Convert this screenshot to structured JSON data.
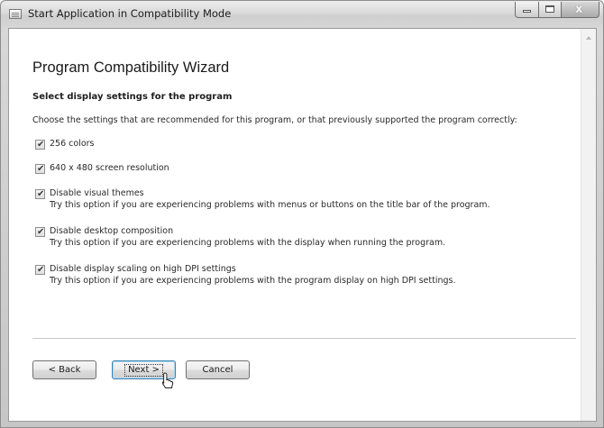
{
  "window": {
    "title": "Start Application in Compatibility Mode"
  },
  "wizard": {
    "title": "Program Compatibility Wizard",
    "section_heading": "Select display settings for the program",
    "intro": "Choose the settings that are recommended for this program, or that previously supported the program correctly:",
    "options": [
      {
        "label": "256 colors",
        "description": "",
        "checked": true
      },
      {
        "label": "640 x 480 screen resolution",
        "description": "",
        "checked": true
      },
      {
        "label": "Disable visual themes",
        "description": "Try this option if you are experiencing problems with menus or buttons on the title bar of the program.",
        "checked": true
      },
      {
        "label": "Disable desktop composition",
        "description": "Try this option if you are experiencing problems with the display when running the program.",
        "checked": true
      },
      {
        "label": "Disable display scaling on high DPI settings",
        "description": "Try this option if you are experiencing problems with the program display on high DPI settings.",
        "checked": true
      }
    ],
    "checkmark_glyph": "✔"
  },
  "buttons": {
    "back": "< Back",
    "next": "Next >",
    "cancel": "Cancel"
  },
  "icons": {
    "app": "window-list-icon",
    "minimize": "minimize-icon",
    "maximize": "maximize-icon",
    "close": "close-icon",
    "cursor": "mouse-pointer-icon"
  },
  "colors": {
    "default_button_border": "#3c7fb1",
    "close_button": "#a9a9a9"
  }
}
